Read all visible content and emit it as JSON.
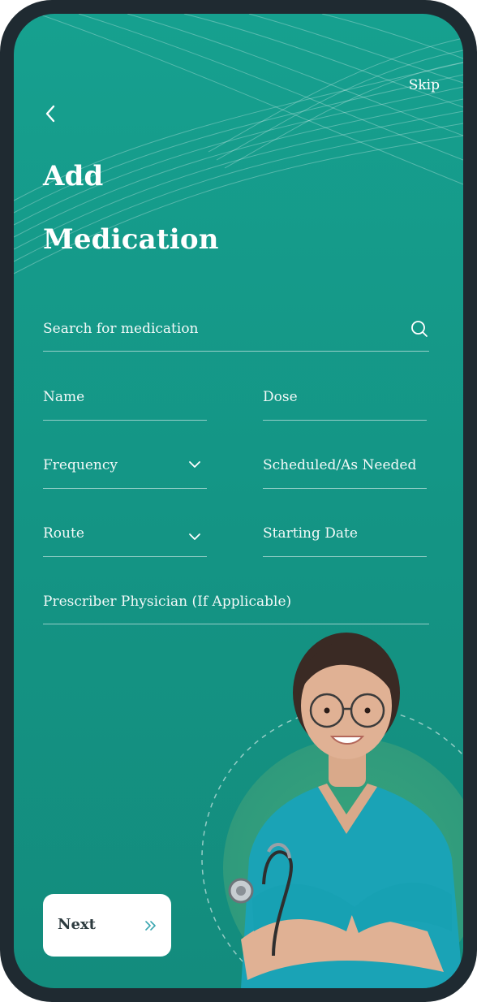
{
  "header": {
    "skip_label": "Skip",
    "title_line1": "Add",
    "title_line2": "Medication"
  },
  "form": {
    "search_placeholder": "Search for medication",
    "name_label": "Name",
    "dose_label": "Dose",
    "frequency_label": "Frequency",
    "scheduled_label": "Scheduled/As Needed",
    "route_label": "Route",
    "starting_date_label": "Starting Date",
    "prescriber_label": "Prescriber Physician (If Applicable)"
  },
  "footer": {
    "next_label": "Next"
  },
  "icons": {
    "back": "chevron-left-icon",
    "search": "search-icon",
    "dropdown": "chevron-down-icon",
    "next": "double-chevron-right-icon"
  },
  "colors": {
    "background": "#149484",
    "frame": "#1f2a31",
    "text": "#ffffff",
    "button_bg": "#ffffff",
    "button_text": "#2d3b3f",
    "accent": "#3aa6b0"
  }
}
